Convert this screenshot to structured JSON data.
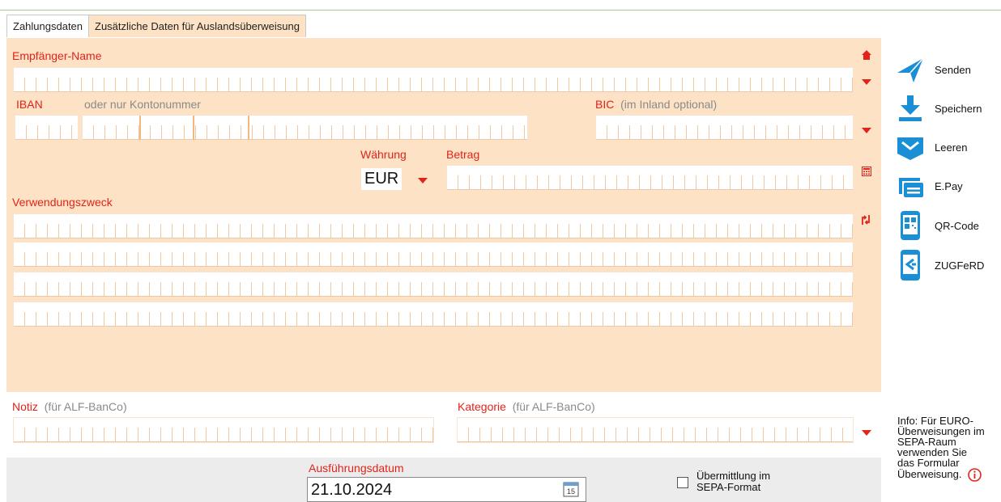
{
  "tabs": [
    "Zahlungsdaten",
    "Zusätzliche Daten für Auslandsüberweisung"
  ],
  "labels": {
    "recipient": "Empfänger-Name",
    "iban": "IBAN",
    "iban_alt": "oder nur Kontonummer",
    "bic": "BIC",
    "bic_hint": "(im Inland optional)",
    "currency": "Währung",
    "amount": "Betrag",
    "purpose": "Verwendungszweck",
    "note": "Notiz",
    "note_hint": "(für ALF-BanCo)",
    "category": "Kategorie",
    "category_hint": "(für ALF-BanCo)",
    "execution_date": "Ausführungsdatum",
    "sepa_line1": "Übermittlung im",
    "sepa_line2": "SEPA-Format"
  },
  "values": {
    "currency": "EUR",
    "execution_date": "21.10.2024",
    "calendar_day": "15"
  },
  "actions": [
    {
      "label": "Senden",
      "icon": "send-icon"
    },
    {
      "label": "Speichern",
      "icon": "download-icon"
    },
    {
      "label": "Leeren",
      "icon": "clear-icon"
    },
    {
      "label": "E.Pay",
      "icon": "epay-icon"
    },
    {
      "label": "QR-Code",
      "icon": "qr-phone-icon"
    },
    {
      "label": "ZUGFeRD",
      "icon": "zugferd-phone-icon"
    }
  ],
  "info": {
    "lines": [
      "Info: Für EURO-",
      "Überweisungen im",
      "SEPA-Raum",
      "verwenden Sie",
      "das Formular",
      "Überweisung."
    ]
  },
  "colors": {
    "accent_red": "#e2231a",
    "form_background": "#fde2c5",
    "action_blue": "#1a8fd6"
  }
}
